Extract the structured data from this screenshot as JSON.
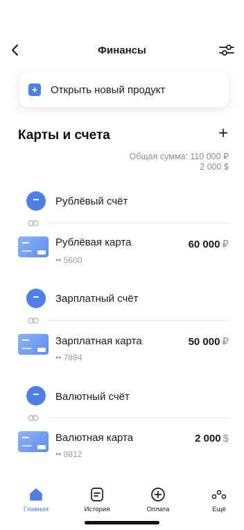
{
  "header": {
    "title": "Финансы"
  },
  "open_product": {
    "label": "Открыть новый продукт"
  },
  "section": {
    "title": "Карты и счета",
    "total_line1": "Общая сумма: 110 000 ₽",
    "total_line2": "2 000 $"
  },
  "accounts": [
    {
      "name": "Рублёвый счёт",
      "card": {
        "name": "Рублёвая карта",
        "number": "•• 5600",
        "amount": "60 000",
        "currency": "₽"
      }
    },
    {
      "name": "Зарплатный счёт",
      "card": {
        "name": "Зарплатная карта",
        "number": "•• 7894",
        "amount": "50 000",
        "currency": "₽"
      }
    },
    {
      "name": "Валютный счёт",
      "card": {
        "name": "Валютная карта",
        "number": "•• 8812",
        "amount": "2 000",
        "currency": "$"
      }
    }
  ],
  "tabs": [
    {
      "label": "Главная",
      "icon": "home-icon",
      "active": true
    },
    {
      "label": "История",
      "icon": "history-icon",
      "active": false
    },
    {
      "label": "Оплата",
      "icon": "payment-plus-icon",
      "active": false
    },
    {
      "label": "Ещё",
      "icon": "more-dots-icon",
      "active": false
    }
  ],
  "colors": {
    "accent": "#4e7fe6",
    "text": "#1b1b1f",
    "muted": "#8a8d94"
  }
}
